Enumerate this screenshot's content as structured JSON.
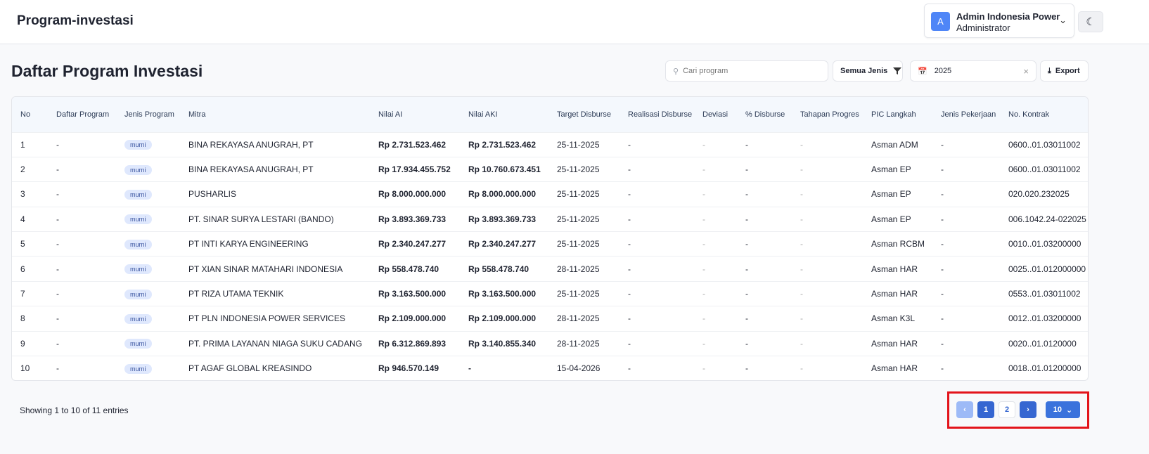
{
  "header": {
    "title": "Program-investasi",
    "user_initial": "A",
    "user_name": "Admin Indonesia Power",
    "user_role": "Administrator"
  },
  "page": {
    "title": "Daftar Program Investasi"
  },
  "toolbar": {
    "search_placeholder": "Cari program",
    "filter_label": "Semua Jenis",
    "year_value": "2025",
    "export_label": "Export"
  },
  "table": {
    "columns": [
      "No",
      "Daftar Program",
      "Jenis Program",
      "Mitra",
      "Nilai AI",
      "Nilai AKI",
      "Target Disburse",
      "Realisasi Disburse",
      "Deviasi",
      "% Disburse",
      "Tahapan Progres",
      "PIC Langkah",
      "Jenis Pekerjaan",
      "No. Kontrak"
    ],
    "rows": [
      [
        "1",
        "-",
        "murni",
        "BINA REKAYASA ANUGRAH, PT",
        "Rp 2.731.523.462",
        "Rp 2.731.523.462",
        "25-11-2025",
        "-",
        "-",
        "-",
        "-",
        "Asman ADM",
        "-",
        "0600..01.03011002"
      ],
      [
        "2",
        "-",
        "murni",
        "BINA REKAYASA ANUGRAH, PT",
        "Rp 17.934.455.752",
        "Rp 10.760.673.451",
        "25-11-2025",
        "-",
        "-",
        "-",
        "-",
        "Asman EP",
        "-",
        "0600..01.03011002"
      ],
      [
        "3",
        "-",
        "murni",
        "PUSHARLIS",
        "Rp 8.000.000.000",
        "Rp 8.000.000.000",
        "25-11-2025",
        "-",
        "-",
        "-",
        "-",
        "Asman EP",
        "-",
        "020.020.232025"
      ],
      [
        "4",
        "-",
        "murni",
        "PT. SINAR SURYA LESTARI (BANDO)",
        "Rp 3.893.369.733",
        "Rp 3.893.369.733",
        "25-11-2025",
        "-",
        "-",
        "-",
        "-",
        "Asman EP",
        "-",
        "006.1042.24-022025"
      ],
      [
        "5",
        "-",
        "murni",
        "PT INTI KARYA ENGINEERING",
        "Rp 2.340.247.277",
        "Rp 2.340.247.277",
        "25-11-2025",
        "-",
        "-",
        "-",
        "-",
        "Asman RCBM",
        "-",
        "0010..01.03200000"
      ],
      [
        "6",
        "-",
        "murni",
        "PT XIAN SINAR MATAHARI INDONESIA",
        "Rp 558.478.740",
        "Rp 558.478.740",
        "28-11-2025",
        "-",
        "-",
        "-",
        "-",
        "Asman HAR",
        "-",
        "0025..01.012000000"
      ],
      [
        "7",
        "-",
        "murni",
        "PT RIZA UTAMA TEKNIK",
        "Rp 3.163.500.000",
        "Rp 3.163.500.000",
        "25-11-2025",
        "-",
        "-",
        "-",
        "-",
        "Asman HAR",
        "-",
        "0553..01.03011002"
      ],
      [
        "8",
        "-",
        "murni",
        "PT PLN INDONESIA POWER SERVICES",
        "Rp 2.109.000.000",
        "Rp 2.109.000.000",
        "28-11-2025",
        "-",
        "-",
        "-",
        "-",
        "Asman K3L",
        "-",
        "0012..01.03200000"
      ],
      [
        "9",
        "-",
        "murni",
        "PT. PRIMA LAYANAN NIAGA SUKU CADANG",
        "Rp 6.312.869.893",
        "Rp 3.140.855.340",
        "28-11-2025",
        "-",
        "-",
        "-",
        "-",
        "Asman HAR",
        "-",
        "0020..01.0120000"
      ],
      [
        "10",
        "-",
        "murni",
        "PT AGAF GLOBAL KREASINDO",
        "Rp 946.570.149",
        "-",
        "15-04-2026",
        "-",
        "-",
        "-",
        "-",
        "Asman HAR",
        "-",
        "0018..01.01200000"
      ]
    ]
  },
  "pagination": {
    "info": "Showing 1 to 10 of 11 entries",
    "pages": [
      "1",
      "2"
    ],
    "current_page": "1",
    "page_size": "10"
  }
}
